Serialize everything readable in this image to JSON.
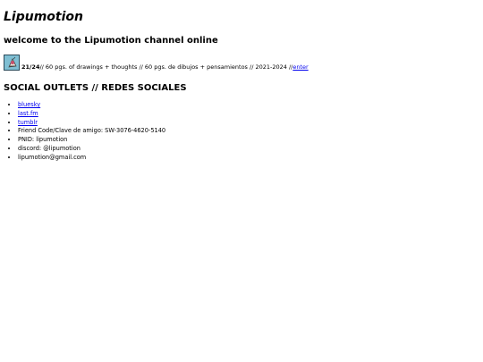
{
  "site": {
    "title": "Lipumotion",
    "welcome": "welcome to the Lipumotion channel online"
  },
  "project": {
    "thumbnail": "drawing-thumbnail",
    "count": "21/24",
    "description": "// 60 pgs. of drawings + thoughts // 60 pgs. de dibujos + pensamientos // 2021-2024 // ",
    "enter_label": "enter"
  },
  "social": {
    "heading": "SOCIAL OUTLETS // REDES SOCIALES",
    "items": [
      {
        "label": "bluesky",
        "link": true
      },
      {
        "label": "last.fm",
        "link": true
      },
      {
        "label": "tumblr",
        "link": true
      },
      {
        "label": "Friend Code/Clave de amigo: SW-3076-4620-5140",
        "link": false
      },
      {
        "label": "PNID: lipumotion",
        "link": false
      },
      {
        "label": "discord: @lipumotion",
        "link": false
      },
      {
        "label": "lipumotion@gmail.com",
        "link": false
      }
    ]
  },
  "colors": {
    "link": "#0000ee",
    "text": "#000000",
    "background": "#ffffff"
  }
}
